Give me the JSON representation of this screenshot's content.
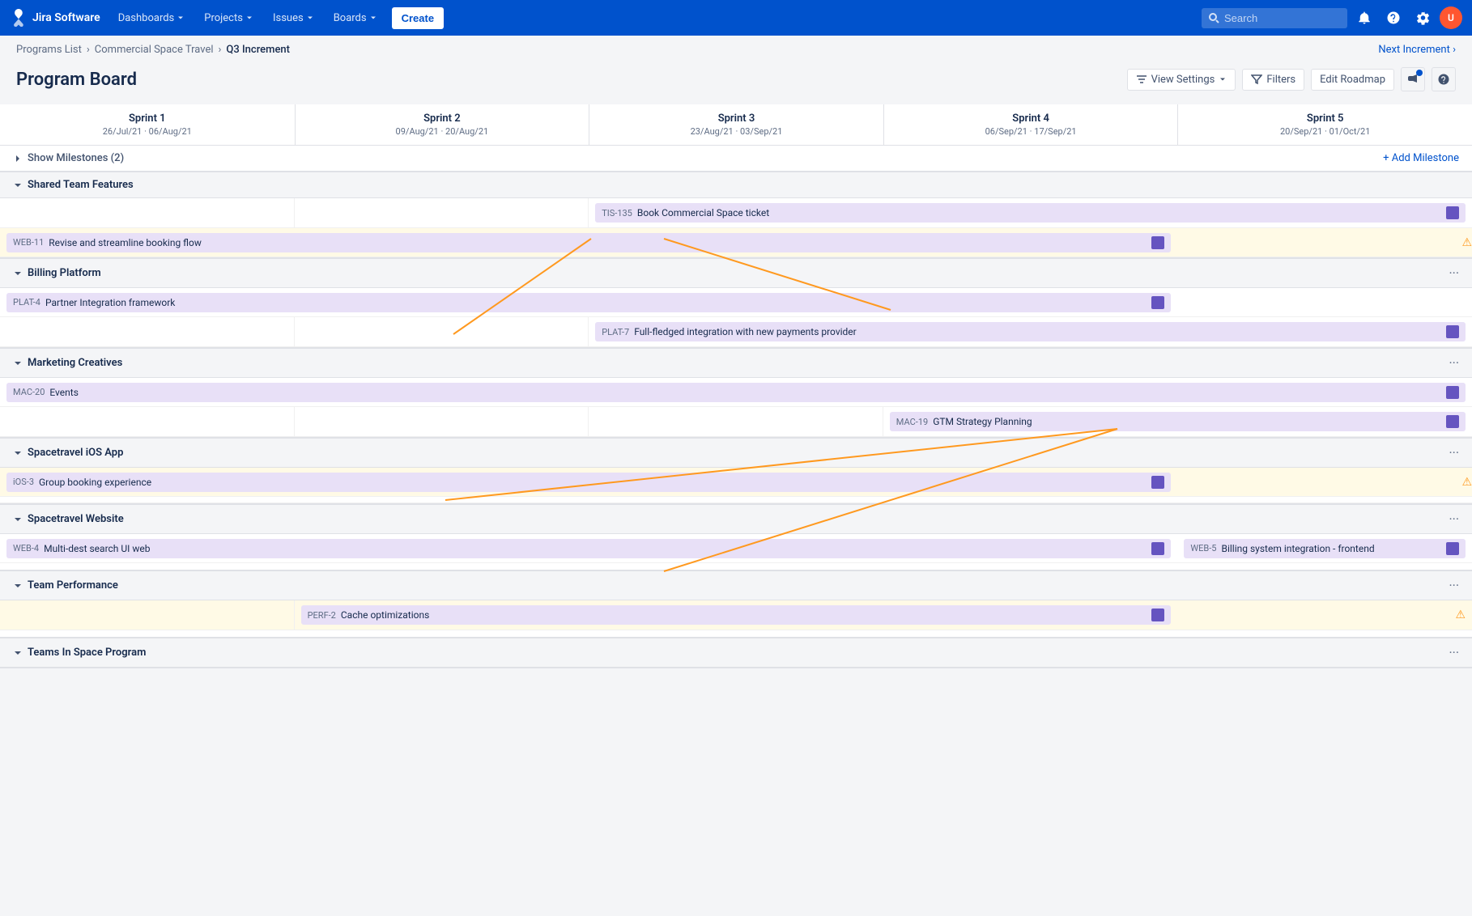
{
  "app": {
    "name": "Jira Software"
  },
  "nav": {
    "dashboards": "Dashboards",
    "projects": "Projects",
    "issues": "Issues",
    "boards": "Boards",
    "create": "Create"
  },
  "search": {
    "placeholder": "Search"
  },
  "breadcrumb": {
    "programs_list": "Programs List",
    "project": "Commercial Space Travel",
    "current": "Q3 Increment",
    "next": "Next Increment ›"
  },
  "page": {
    "title": "Program Board",
    "view_settings": "View Settings",
    "filters": "Filters",
    "edit_roadmap": "Edit Roadmap"
  },
  "sprints": [
    {
      "name": "Sprint 1",
      "dates": "26/Jul/21 · 06/Aug/21"
    },
    {
      "name": "Sprint 2",
      "dates": "09/Aug/21 · 20/Aug/21"
    },
    {
      "name": "Sprint 3",
      "dates": "23/Aug/21 · 03/Sep/21"
    },
    {
      "name": "Sprint 4",
      "dates": "06/Sep/21 · 17/Sep/21"
    },
    {
      "name": "Sprint 5",
      "dates": "20/Sep/21 · 01/Oct/21"
    }
  ],
  "milestones": {
    "label": "Show Milestones (2)",
    "add": "+ Add Milestone"
  },
  "teams": [
    {
      "name": "Shared Team Features",
      "features": [
        {
          "id": "TIS-135",
          "title": "Book Commercial Space ticket",
          "col_start": 3,
          "col_end": 5,
          "type": "normal",
          "has_icon": true
        },
        {
          "id": "WEB-11",
          "title": "Revise and streamline booking flow",
          "col_start": 1,
          "col_end": 4,
          "type": "warning",
          "has_icon": true,
          "has_warning": true
        }
      ]
    },
    {
      "name": "Billing Platform",
      "features": [
        {
          "id": "PLAT-4",
          "title": "Partner Integration framework",
          "col_start": 1,
          "col_end": 4,
          "type": "normal",
          "has_icon": true
        },
        {
          "id": "PLAT-7",
          "title": "Full-fledged integration with new payments provider",
          "col_start": 3,
          "col_end": 5,
          "type": "normal",
          "has_icon": true
        }
      ]
    },
    {
      "name": "Marketing Creatives",
      "features": [
        {
          "id": "MAC-20",
          "title": "Events",
          "col_start": 1,
          "col_end": 5,
          "type": "normal",
          "has_icon": true
        },
        {
          "id": "MAC-19",
          "title": "GTM Strategy Planning",
          "col_start": 4,
          "col_end": 5,
          "type": "normal",
          "has_icon": true
        }
      ]
    },
    {
      "name": "Spacetravel iOS App",
      "features": [
        {
          "id": "iOS-3",
          "title": "Group booking experience",
          "col_start": 1,
          "col_end": 4,
          "type": "warning",
          "has_icon": true,
          "has_warning": true
        }
      ]
    },
    {
      "name": "Spacetravel Website",
      "features": [
        {
          "id": "WEB-4",
          "title": "Multi-dest search UI web",
          "col_start": 1,
          "col_end": 4,
          "type": "normal",
          "has_icon": true
        },
        {
          "id": "WEB-5",
          "title": "Billing system integration - frontend",
          "col_start": 4,
          "col_end": 5,
          "type": "normal",
          "has_icon": true
        }
      ]
    },
    {
      "name": "Team Performance",
      "features": [
        {
          "id": "PERF-2",
          "title": "Cache optimizations",
          "col_start": 2,
          "col_end": 4,
          "type": "warning",
          "has_icon": true,
          "has_warning": true
        }
      ]
    },
    {
      "name": "Teams In Space Program",
      "features": []
    }
  ]
}
